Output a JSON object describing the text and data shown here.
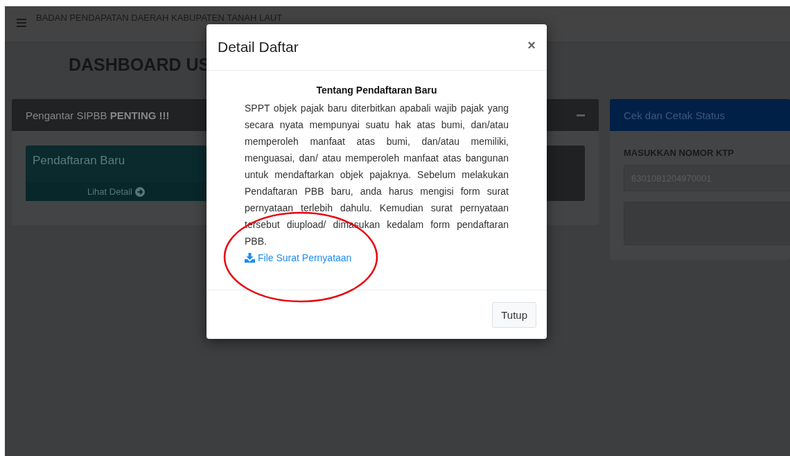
{
  "navbar": {
    "title": "BADAN PENDAPATAN DAERAH KABUPATEN TANAH LAUT"
  },
  "page": {
    "title": "DASHBOARD US"
  },
  "intro_card": {
    "header": "Pengantar SIPBB **PENTING !!!**",
    "box": {
      "title": "Pendaftaran Baru",
      "link": "Lihat Detail"
    }
  },
  "status_card": {
    "header": "Cek dan Cetak Status",
    "label": "MASUKKAN NOMOR KTP",
    "input": {
      "value": "6301081204970001"
    }
  },
  "modal": {
    "title": "Detail Daftar",
    "close": "×",
    "heading": "Tentang Pendaftaran Baru",
    "paragraph": "SPPT objek pajak baru diterbitkan apabali wajib pajak yang secara nyata mempunyai suatu hak atas bumi, dan/atau memperoleh manfaat atas bumi, dan/atau memiliki, menguasai, dan/ atau memperoleh manfaat atas bangunan untuk mendaftarkan objek pajaknya. Sebelum melakukan Pendaftaran PBB baru, anda harus mengisi form surat pernyataan terlebih dahulu. Kemudian surat pernyataan tersebut diupload/ dimasukan kedalam form pendaftaran PBB.",
    "link": "File Surat Pernyataan",
    "button": "Tutup"
  }
}
